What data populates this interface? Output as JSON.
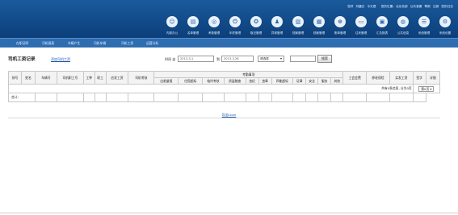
{
  "header": {
    "top_links": [
      "您好",
      "刘晨日",
      "今天是",
      "",
      "您的位置：北京总部",
      "公共查看",
      "帮助",
      "注销",
      "您的日志"
    ],
    "toolbar_icons": [
      {
        "icon": "people-icon",
        "label": "内部办公"
      },
      {
        "icon": "book-icon",
        "label": "名单管理"
      },
      {
        "icon": "target-icon",
        "label": "考核管理"
      },
      {
        "icon": "power-icon",
        "label": "年终管理"
      },
      {
        "icon": "badge-icon",
        "label": "取记管理"
      },
      {
        "icon": "person-icon",
        "label": "异常管理"
      },
      {
        "icon": "chart-icon",
        "label": "档案管理"
      },
      {
        "icon": "document-icon",
        "label": "档案管理"
      },
      {
        "icon": "stamp-icon",
        "label": "账单管理"
      },
      {
        "icon": "card-icon",
        "label": "往来管理"
      },
      {
        "icon": "folder-icon",
        "label": "汇总报表"
      },
      {
        "icon": "globe-icon",
        "label": "公共信息"
      },
      {
        "icon": "stack-icon",
        "label": "系统管理"
      },
      {
        "icon": "settings-icon",
        "label": "系统设置"
      }
    ]
  },
  "nav": [
    "在职证明",
    "司机报表",
    "车辆产生",
    "司机车辆",
    "司机工资",
    "运营分析"
  ],
  "toolbar": {
    "title": "司机工资记录",
    "add_link": "添加司机工资",
    "date_label": "时间 自",
    "date_from": "2013-3-1",
    "to_label": "到",
    "date_to": "2013-3-26",
    "dept": "请选择",
    "search_value": "",
    "query": "搜索"
  },
  "table": {
    "group_header": "考勤事项",
    "headers_left": [
      "排号",
      "姓名",
      "车辆号",
      "司机职工号",
      "工种",
      "职工",
      "应发工资",
      "司机考核"
    ],
    "headers_group": [
      "出差量报",
      "住宿超标",
      "临时考核",
      "质监稽查",
      "违纪",
      "违章",
      "四能超标",
      "证章",
      "安全",
      "服务",
      "其他"
    ],
    "headers_right": [
      "工会会费",
      "养老保险",
      "实发工资",
      "签字",
      "详细"
    ],
    "pager_text": "共有0条信息, 分为0页",
    "pager_select": "第0页",
    "total_label": "合计："
  },
  "footer": {
    "link": "导出Excel"
  }
}
